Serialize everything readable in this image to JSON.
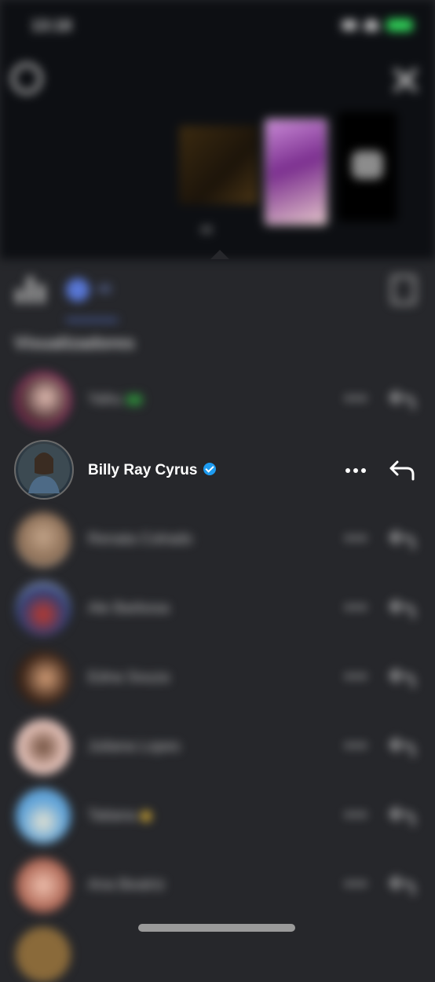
{
  "status": {
    "time": "13:18"
  },
  "story": {
    "view_count": "46"
  },
  "toolbar": {
    "viewers_count": "46"
  },
  "section": {
    "label": "Visualizadores"
  },
  "viewers": [
    {
      "name": "Yahu",
      "badge": "green-badge"
    },
    {
      "name": "Billy Ray Cyrus",
      "verified": true
    },
    {
      "name": "Renata Colrado"
    },
    {
      "name": "Ale Barbosa"
    },
    {
      "name": "Edna Souza"
    },
    {
      "name": "Juliana Lopes"
    },
    {
      "name": "Tatiana",
      "badge": "star"
    },
    {
      "name": "Ana Beatriz"
    }
  ],
  "colors": {
    "background": "#26272b",
    "top_area": "#0d0f13",
    "accent": "#5877d6",
    "verified": "#1d9bf0",
    "story_ring": "#c8347f"
  }
}
